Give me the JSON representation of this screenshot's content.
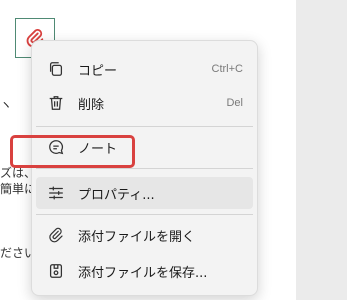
{
  "background": {
    "arrow_fragment": "ヽ",
    "text_fragment_1": "ズは、",
    "text_fragment_2": "簡単に",
    "text_fragment_3": "ださい",
    "attachment_icon": "paperclip-icon",
    "accent_color": "#d9413f"
  },
  "menu": {
    "items": [
      {
        "label": "コピー",
        "shortcut": "Ctrl+C",
        "icon": "copy-icon"
      },
      {
        "label": "削除",
        "shortcut": "Del",
        "icon": "trash-icon"
      },
      {
        "label": "ノート",
        "shortcut": "",
        "icon": "note-icon"
      },
      {
        "label": "プロパティ...",
        "shortcut": "",
        "icon": "properties-icon"
      },
      {
        "label": "添付ファイルを開く",
        "shortcut": "",
        "icon": "open-attachment-icon"
      },
      {
        "label": "添付ファイルを保存...",
        "shortcut": "",
        "icon": "save-attachment-icon"
      }
    ]
  }
}
